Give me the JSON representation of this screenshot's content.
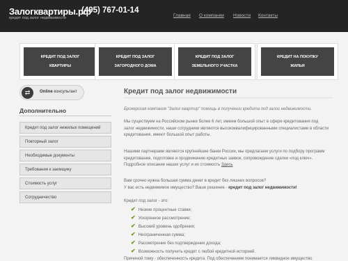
{
  "header": {
    "logo": "Залогквартиры.рф",
    "logo_subtitle": "кредит под залог недвижимости",
    "phone": "(495) 767-01-14",
    "nav": [
      "Главная",
      "О компании",
      "Новости",
      "Контакты"
    ]
  },
  "banners": [
    {
      "line1": "КРЕДИТ ПОД ЗАЛОГ",
      "line2": "КВАРТИРЫ"
    },
    {
      "line1": "КРЕДИТ ПОД ЗАЛОГ",
      "line2": "ЗАГОРОДНОГО ДОМА"
    },
    {
      "line1": "КРЕДИТ ПОД ЗАЛОГ",
      "line2": "ЗЕМЕЛЬНОГО УЧАСТКА"
    },
    {
      "line1": "КРЕДИТ НА ПОКУПКУ",
      "line2": "ЖИЛЬЯ"
    }
  ],
  "sidebar": {
    "online_bold": "Online",
    "online_rest": " консультант",
    "title": "Дополнительно",
    "items": [
      "Кредит под залог нежилых помещений",
      "Повторный залог",
      "Необходимые документы",
      "Требования к заемщику",
      "Стоимость услуг",
      "Сотрудничество"
    ]
  },
  "main": {
    "title": "Кредит под залог недвижимости",
    "intro": "Брокерская компания \"Залог квартир\" помощь в получении кредита под залог недвижимости.",
    "p1": "Мы существуем на Российском рынке более 6 лет, имеем большой опыт в сфере кредитования под залог недвижимости, наши сотрудники являются высококвалифицированными специалистами в области кредитования, имеют большой опыт работы.",
    "p2_text": "Нашими партнерами являются крупнейшие банки России, мы предлагаем услуги по подбору программ кредитования, подготовке и продвижению кредитных заявок, сопровождение сделки «под ключ». Подробное описание наших услуг и их стоимость ",
    "p2_link": "Здесь",
    "p3_line1": "Вам срочно нужна большая сумма денег в кредит без лишних вопросов?",
    "p3_line2_text": "У вас есть недвижимое имущество? Ваше решение - ",
    "p3_line2_bold": "кредит под залог недвижимости!",
    "list_title": "Кредит под залог - это:",
    "list": [
      "Низкие процентные ставки;",
      "Ускоренное рассмотрение;",
      "Высокий уровень одобрения;",
      "Неограниченная сумма;",
      "Рассмотрение без подтверждения дохода;",
      "Возможность получить кредит с любой кредитной историей."
    ],
    "tail": "Причиной тому - обеспеченность кредита. Под обеспечением понимается ликвидное имущество"
  }
}
